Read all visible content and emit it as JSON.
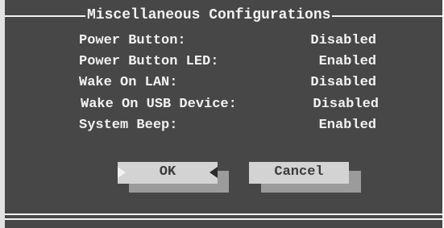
{
  "dialog": {
    "title": "Miscellaneous Configurations",
    "settings": [
      {
        "label": "Power Button:",
        "value": "Disabled"
      },
      {
        "label": "Power Button LED:",
        "value": "Enabled"
      },
      {
        "label": "Wake On LAN:",
        "value": "Disabled"
      },
      {
        "label": "Wake On USB Device:",
        "value": "Disabled"
      },
      {
        "label": "System Beep:",
        "value": "Enabled"
      }
    ],
    "buttons": {
      "ok_label": "OK",
      "cancel_label": "Cancel"
    }
  },
  "colors": {
    "dialog_bg": "#474747",
    "text": "#f2f2f2",
    "button_face": "#d3d3d3",
    "button_shadow": "#9b9b9b"
  }
}
